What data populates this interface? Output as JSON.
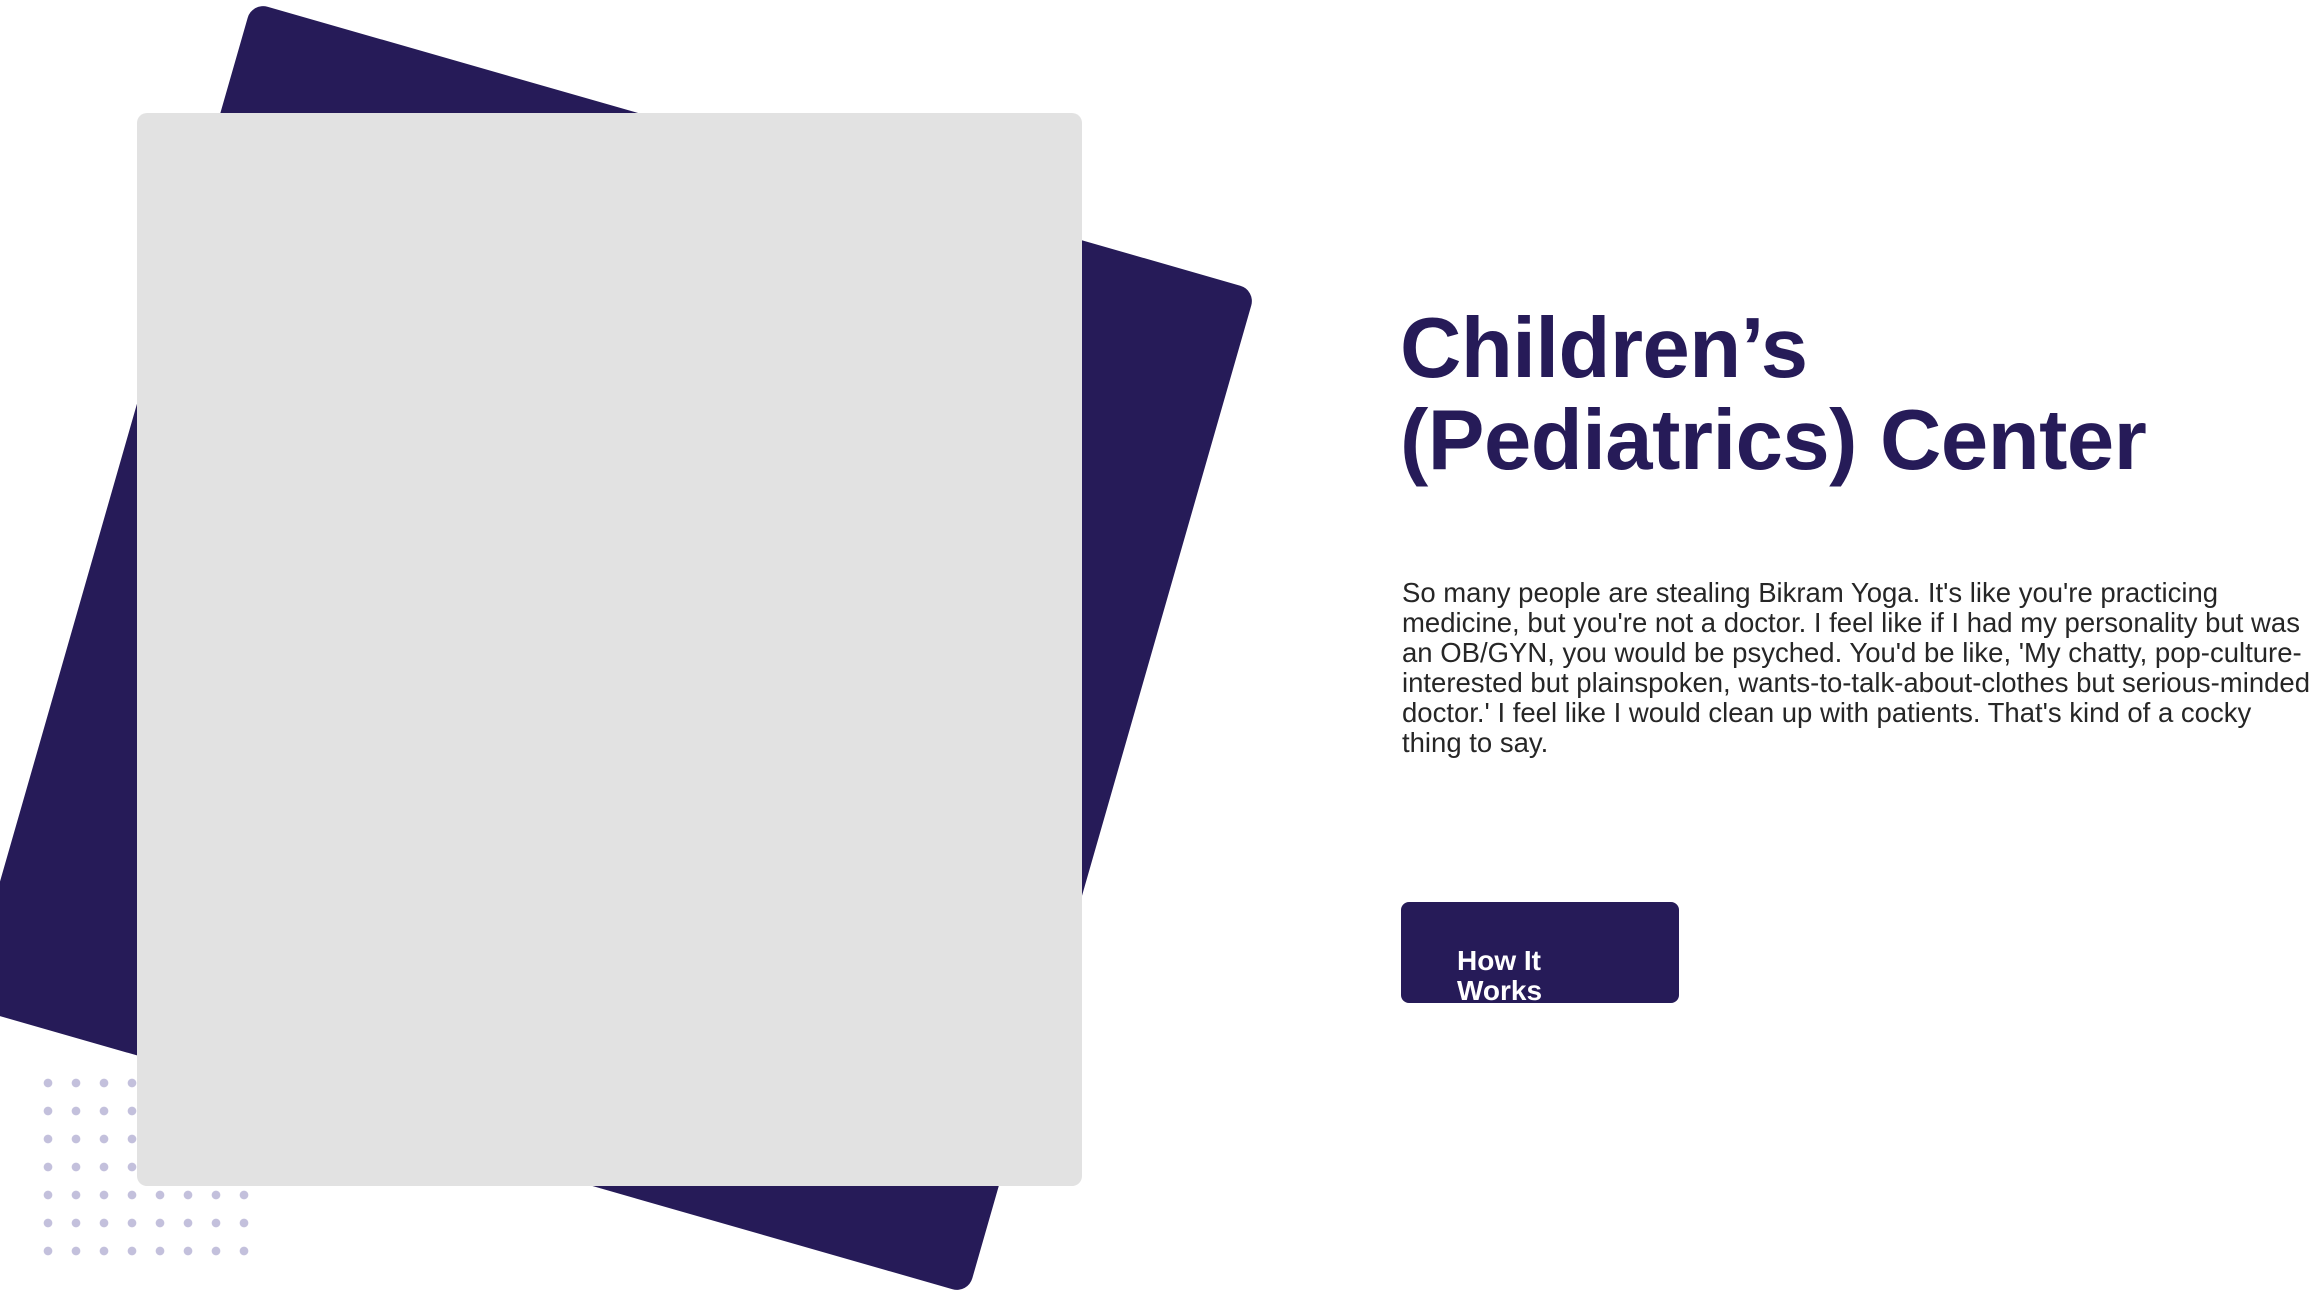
{
  "colors": {
    "brand": "#261b58",
    "placeholder": "#e2e2e2",
    "dots": "#c3c0dc",
    "body_text": "#262626",
    "button_text": "#ffffff"
  },
  "hero": {
    "title": "Children’s (Pediatrics) Center",
    "description": "So many people are stealing Bikram Yoga. It's like you're practicing medicine, but you're not a doctor. I feel like if I had my personality but was an OB/GYN, you would be psyched. You'd be like, 'My chatty, pop-culture-interested but plainspoken, wants-to-talk-about-clothes but serious-minded doctor.' I feel like I would clean up with patients. That's kind of a cocky thing to say.",
    "cta_label": "How It Works"
  }
}
